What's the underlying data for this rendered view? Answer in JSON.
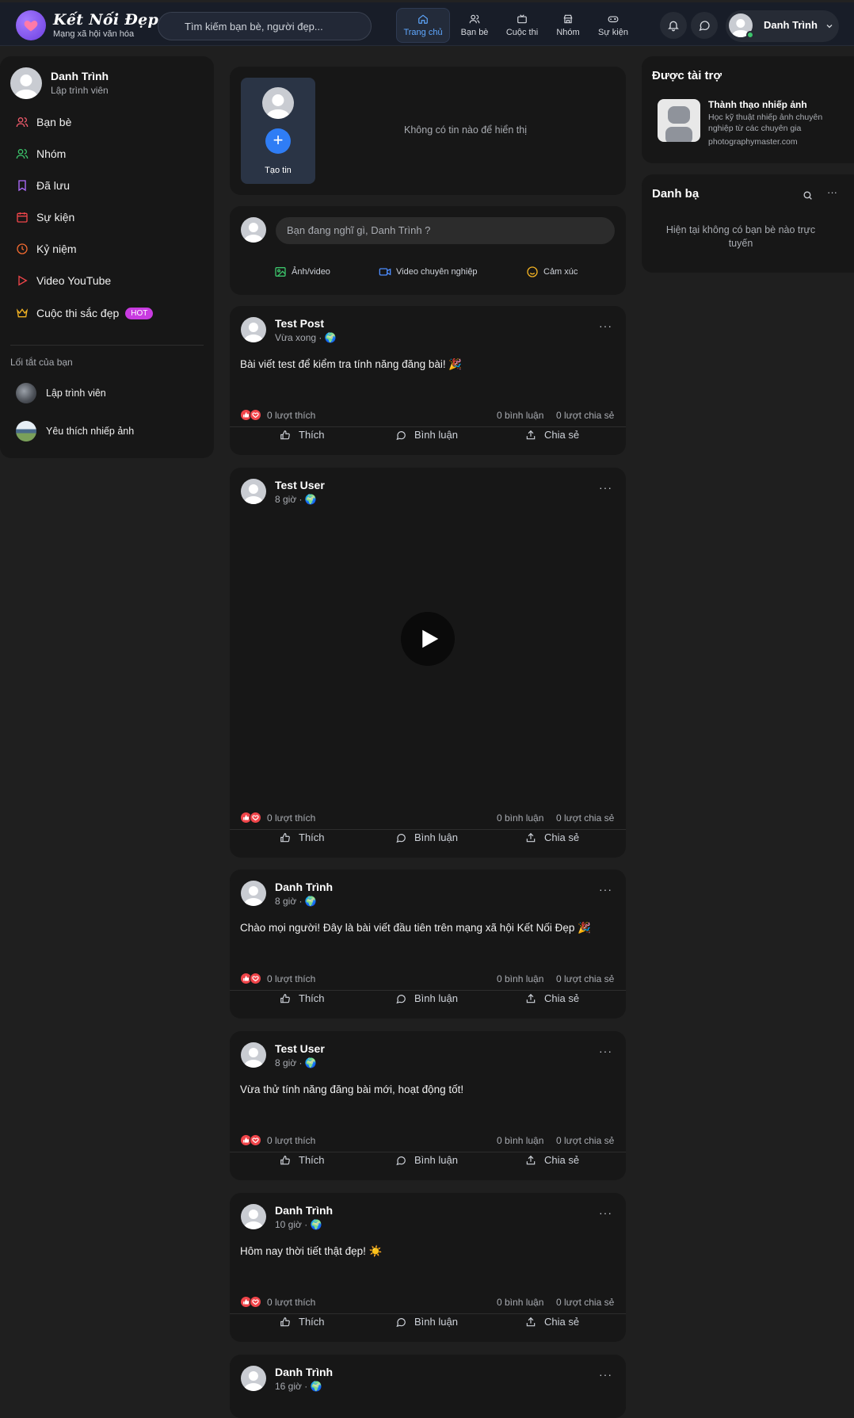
{
  "brand": {
    "name": "Kết Nối Đẹp",
    "tagline": "Mạng xã hội văn hóa"
  },
  "search": {
    "placeholder": "Tìm kiếm bạn bè, người đẹp..."
  },
  "nav": [
    {
      "label": "Trang chủ",
      "icon": "home-icon"
    },
    {
      "label": "Bạn bè",
      "icon": "friends-icon"
    },
    {
      "label": "Cuộc thi",
      "icon": "contest-icon"
    },
    {
      "label": "Nhóm",
      "icon": "group-icon"
    },
    {
      "label": "Sự kiện",
      "icon": "event-icon"
    }
  ],
  "user": {
    "name": "Danh Trình",
    "role": "Lập trình viên"
  },
  "sidebar": {
    "items": [
      {
        "label": "Bạn bè",
        "icon": "friends-icon",
        "color": "#f05a6b"
      },
      {
        "label": "Nhóm",
        "icon": "group-icon",
        "color": "#3cc46b"
      },
      {
        "label": "Đã lưu",
        "icon": "bookmark-icon",
        "color": "#b06cff"
      },
      {
        "label": "Sự kiện",
        "icon": "calendar-icon",
        "color": "#f0454a"
      },
      {
        "label": "Kỷ niệm",
        "icon": "clock-icon",
        "color": "#f06a30"
      },
      {
        "label": "Video YouTube",
        "icon": "play-icon",
        "color": "#f0454a"
      },
      {
        "label": "Cuộc thi sắc đẹp",
        "icon": "crown-icon",
        "color": "#f3b323",
        "badge": "HOT"
      }
    ],
    "shortcuts_title": "Lối tắt của bạn",
    "shortcuts": [
      {
        "label": "Lập trình viên"
      },
      {
        "label": "Yêu thích nhiếp ảnh"
      }
    ]
  },
  "stories": {
    "create_label": "Tạo tin",
    "empty_text": "Không có tin nào để hiển thị"
  },
  "composer": {
    "placeholder": "Bạn đang nghĩ gì, Danh Trình ?",
    "photo": "Ảnh/video",
    "video": "Video chuyên nghiệp",
    "feeling": "Cảm xúc"
  },
  "labels": {
    "like": "Thích",
    "comment": "Bình luận",
    "share": "Chia sẻ"
  },
  "posts": [
    {
      "author": "Test Post",
      "time": "Vừa xong · 🌍",
      "text": "Bài viết test để kiểm tra tính năng đăng bài! 🎉",
      "likes": "0 lượt thích",
      "comments": "0 bình luận",
      "shares": "0 lượt chia sẻ"
    },
    {
      "author": "Test User",
      "time": "8 giờ · 🌍",
      "text": "",
      "likes": "0 lượt thích",
      "comments": "0 bình luận",
      "shares": "0 lượt chia sẻ"
    },
    {
      "author": "Danh Trình",
      "time": "8 giờ · 🌍",
      "text": "Chào mọi người! Đây là bài viết đầu tiên trên mạng xã hội Kết Nối Đẹp 🎉",
      "likes": "0 lượt thích",
      "comments": "0 bình luận",
      "shares": "0 lượt chia sẻ"
    },
    {
      "author": "Test User",
      "time": "8 giờ · 🌍",
      "text": "Vừa thử tính năng đăng bài mới, hoạt động tốt!",
      "likes": "0 lượt thích",
      "comments": "0 bình luận",
      "shares": "0 lượt chia sẻ"
    },
    {
      "author": "Danh Trình",
      "time": "10 giờ · 🌍",
      "text": "Hôm nay thời tiết thật đẹp! ☀️",
      "likes": "0 lượt thích",
      "comments": "0 bình luận",
      "shares": "0 lượt chia sẻ"
    },
    {
      "author": "Danh Trình",
      "time": "16 giờ · 🌍",
      "text": "",
      "likes": "",
      "comments": "",
      "shares": ""
    }
  ],
  "sponsored": {
    "title": "Được tài trợ",
    "ad_title": "Thành thạo nhiếp ảnh",
    "ad_desc": "Học kỹ thuật nhiếp ảnh chuyên nghiệp từ các chuyên gia",
    "ad_url": "photographymaster.com"
  },
  "contacts": {
    "title": "Danh bạ",
    "empty_text": "Hiện tại không có bạn bè nào trực tuyến"
  },
  "colors": {
    "accent": "#4d8dff",
    "hot_badge": "#c83be0",
    "online": "#3cc46b"
  }
}
